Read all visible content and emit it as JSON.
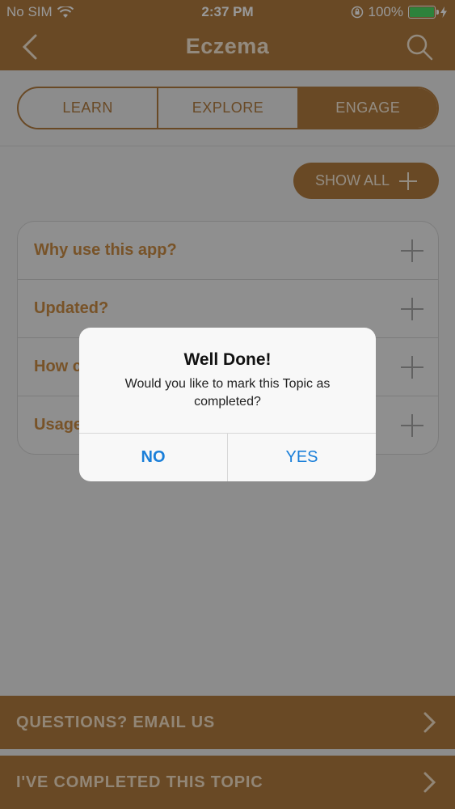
{
  "status_bar": {
    "carrier": "No SIM",
    "time": "2:37 PM",
    "battery": "100%",
    "battery_level": 1.0
  },
  "nav": {
    "title": "Eczema",
    "back_icon": "chevron-left-icon",
    "search_icon": "search-icon"
  },
  "tabs": [
    {
      "label": "LEARN",
      "active": false
    },
    {
      "label": "EXPLORE",
      "active": false
    },
    {
      "label": "ENGAGE",
      "active": true
    }
  ],
  "show_all": {
    "label": "SHOW ALL",
    "icon": "plus-icon"
  },
  "accordion": [
    {
      "label": "Why use this app?"
    },
    {
      "label": "Updated?"
    },
    {
      "label": "How c"
    },
    {
      "label": "Usage"
    }
  ],
  "footer": {
    "email_label": "QUESTIONS? EMAIL US",
    "completed_label": "I'VE COMPLETED THIS TOPIC"
  },
  "dialog": {
    "title": "Well Done!",
    "message": "Would you like to mark this Topic as completed?",
    "no_label": "NO",
    "yes_label": "YES"
  },
  "colors": {
    "brand": "#b07a3e",
    "accent_text": "#c88a44",
    "dialog_button": "#1a7fd9"
  }
}
